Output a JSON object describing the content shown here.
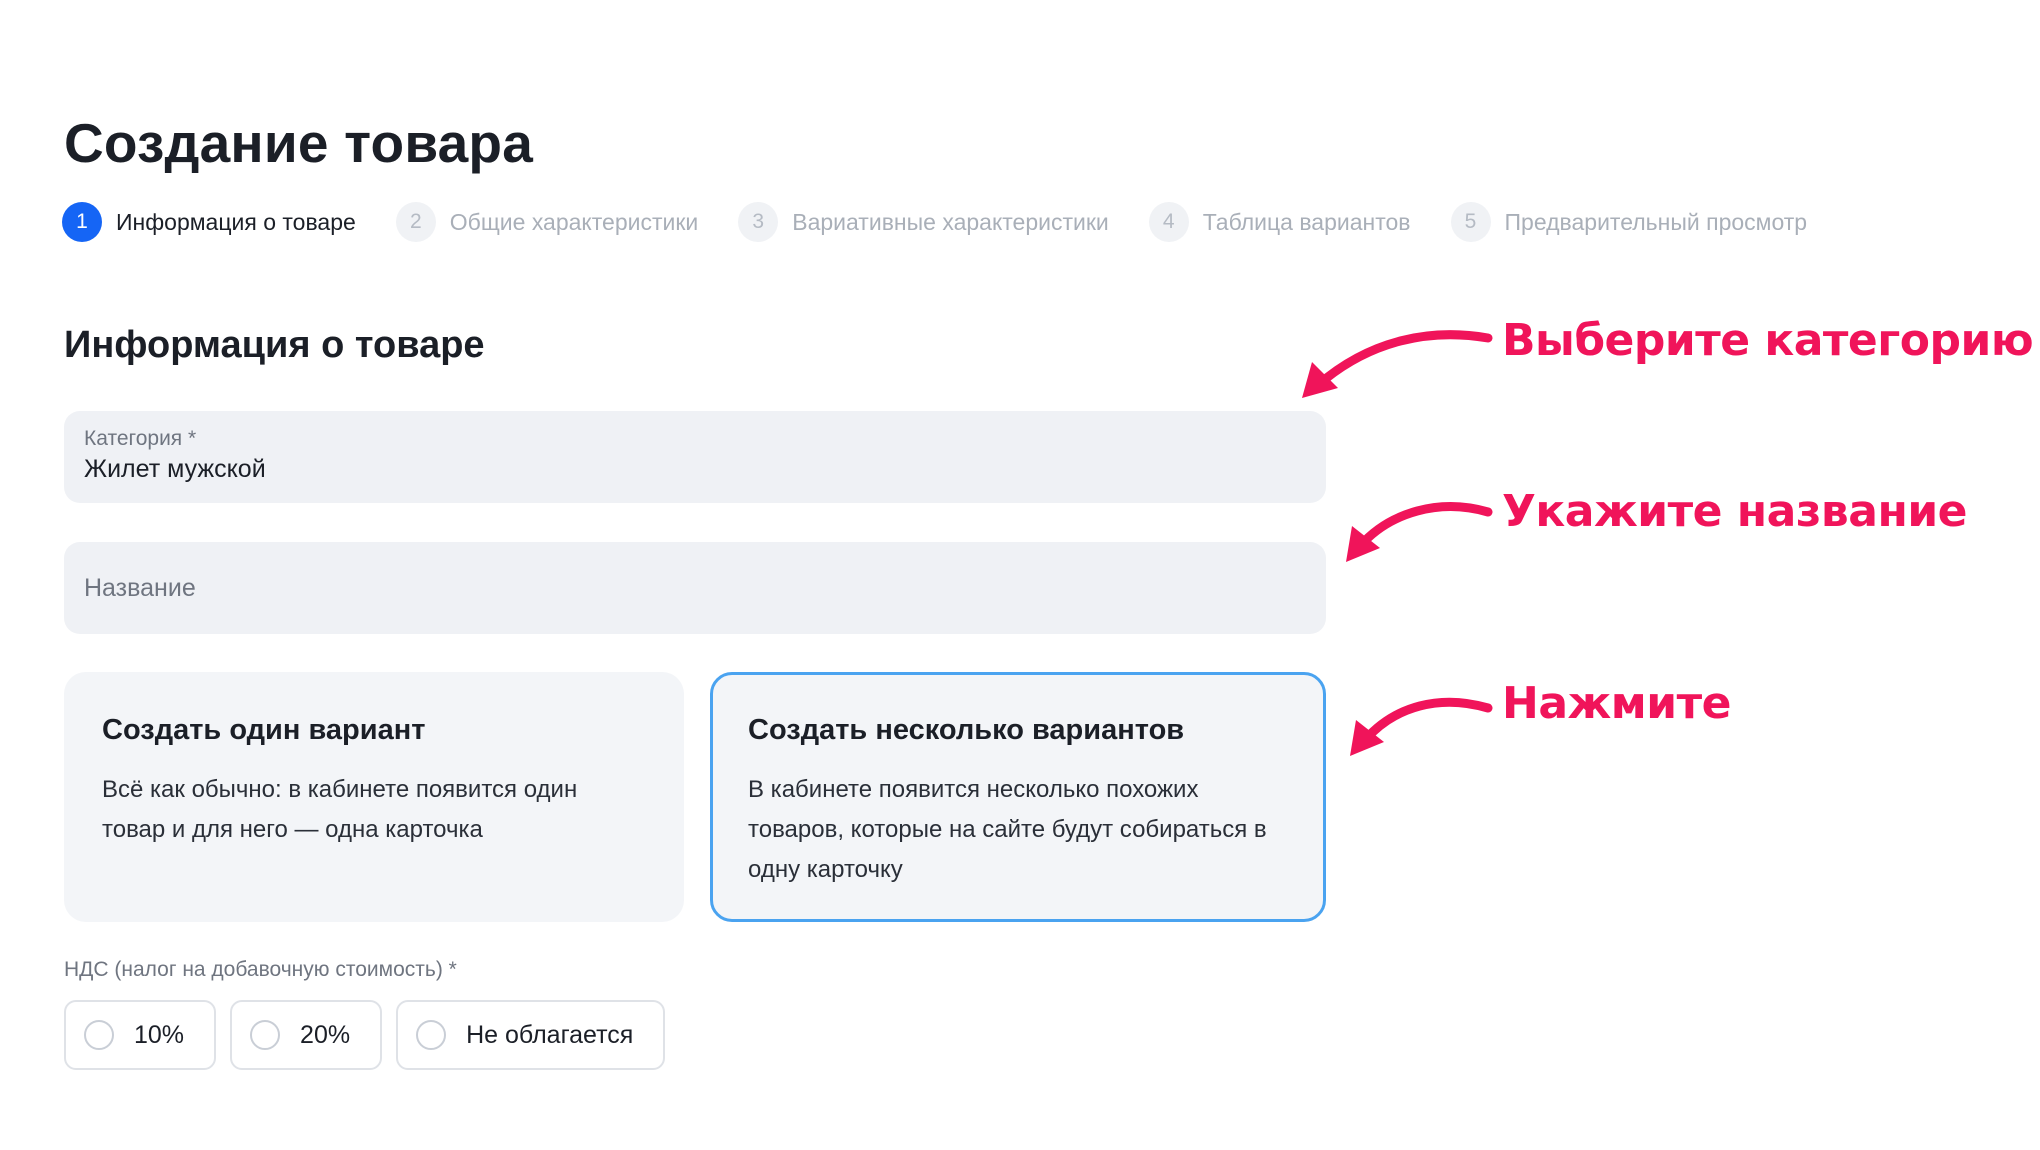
{
  "page": {
    "title": "Создание товара"
  },
  "steps": [
    {
      "number": "1",
      "label": "Информация о товаре",
      "active": true
    },
    {
      "number": "2",
      "label": "Общие характеристики",
      "active": false
    },
    {
      "number": "3",
      "label": "Вариативные характеристики",
      "active": false
    },
    {
      "number": "4",
      "label": "Таблица вариантов",
      "active": false
    },
    {
      "number": "5",
      "label": "Предварительный просмотр",
      "active": false
    }
  ],
  "section": {
    "title": "Информация о товаре"
  },
  "category_field": {
    "label": "Категория *",
    "value": "Жилет мужской"
  },
  "name_field": {
    "placeholder": "Название",
    "value": ""
  },
  "options": {
    "one": {
      "title": "Создать один вариант",
      "description": "Всё как обычно: в кабинете появится один товар и для него — одна карточка",
      "selected": false
    },
    "many": {
      "title": "Создать несколько вариантов",
      "description": "В кабинете появится несколько похожих товаров, которые на сайте будут собираться в одну карточку",
      "selected": true
    }
  },
  "vat": {
    "label": "НДС (налог на добавочную стоимость) *",
    "options": [
      "10%",
      "20%",
      "Не облагается"
    ]
  },
  "annotations": {
    "select_category": "Выберите категорию",
    "enter_name": "Укажите название",
    "click": "Нажмите"
  },
  "colors": {
    "accent": "#1565f5",
    "annotation": "#f0145a",
    "selected_border": "#4aa3f0",
    "field_background": "#eff1f5"
  }
}
